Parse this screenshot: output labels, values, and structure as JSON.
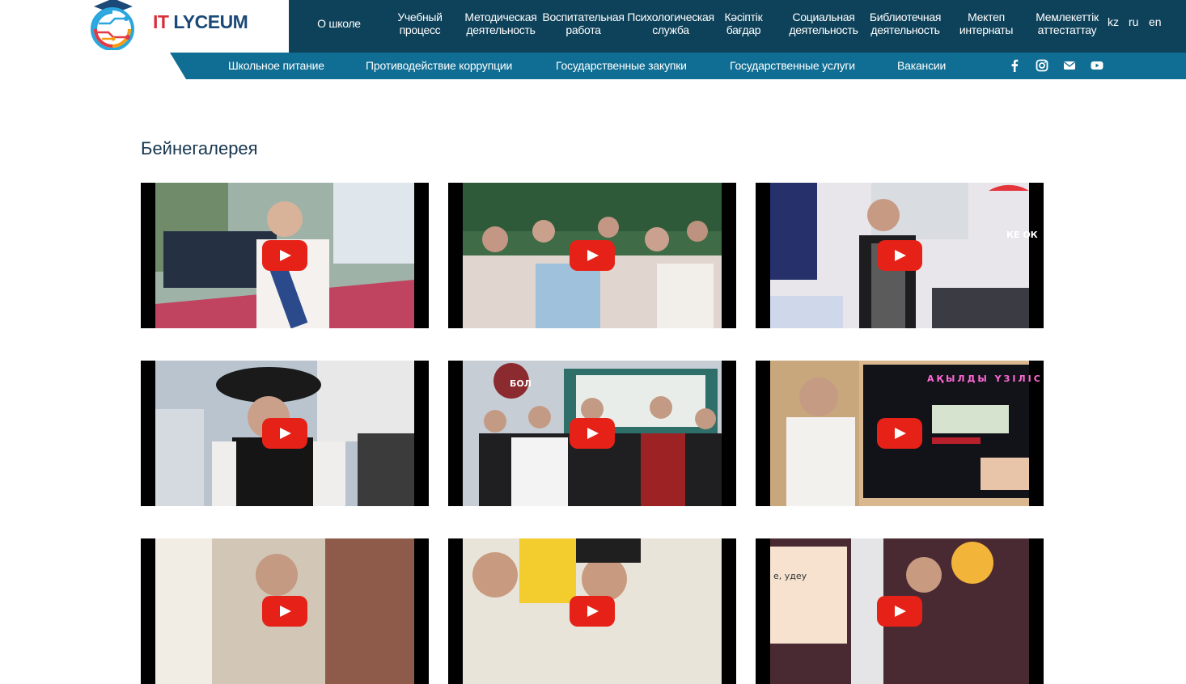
{
  "brand": {
    "logo_it": "IT",
    "logo_rest": "LYCEUM"
  },
  "topnav": {
    "items": [
      "О школе",
      "Учебный\nпроцесс",
      "Методическая\nдеятельность",
      "Воспитательная\nработа",
      "Психологическая\nслужба",
      "Кәсіптік\nбағдар",
      "Социальная\nдеятельность",
      "Библиотечная\nдеятельность",
      "Мектеп\nинтернаты",
      "Мемлекеттік\nаттестаттау"
    ],
    "languages": [
      "kz",
      "ru",
      "en"
    ]
  },
  "subnav": {
    "items": [
      "Школьное питание",
      "Противодействие коррупции",
      "Государственные закупки",
      "Государственные услуги",
      "Вакансии"
    ],
    "social_icons": [
      "facebook-icon",
      "instagram-icon",
      "email-icon",
      "youtube-icon"
    ]
  },
  "gallery": {
    "title": "Бейнегалерея",
    "thumb_texts": [
      "АҚЫЛДЫ ҮЗІЛІС",
      "БОЛ",
      "КЕ ОК",
      "е, удеу"
    ],
    "videos": [
      {
        "scene": "graduation-speech"
      },
      {
        "scene": "audience-hall"
      },
      {
        "scene": "apron-class"
      },
      {
        "scene": "boy-with-hat"
      },
      {
        "scene": "group-national-dress"
      },
      {
        "scene": "smartboard-presentation"
      },
      {
        "scene": "teacher-library"
      },
      {
        "scene": "classroom-women"
      },
      {
        "scene": "toys-room"
      }
    ]
  },
  "colors": {
    "topnav_bg": "#0e425a",
    "subnav_bg": "#106e94",
    "title": "#17374f",
    "play": "#e62117"
  }
}
